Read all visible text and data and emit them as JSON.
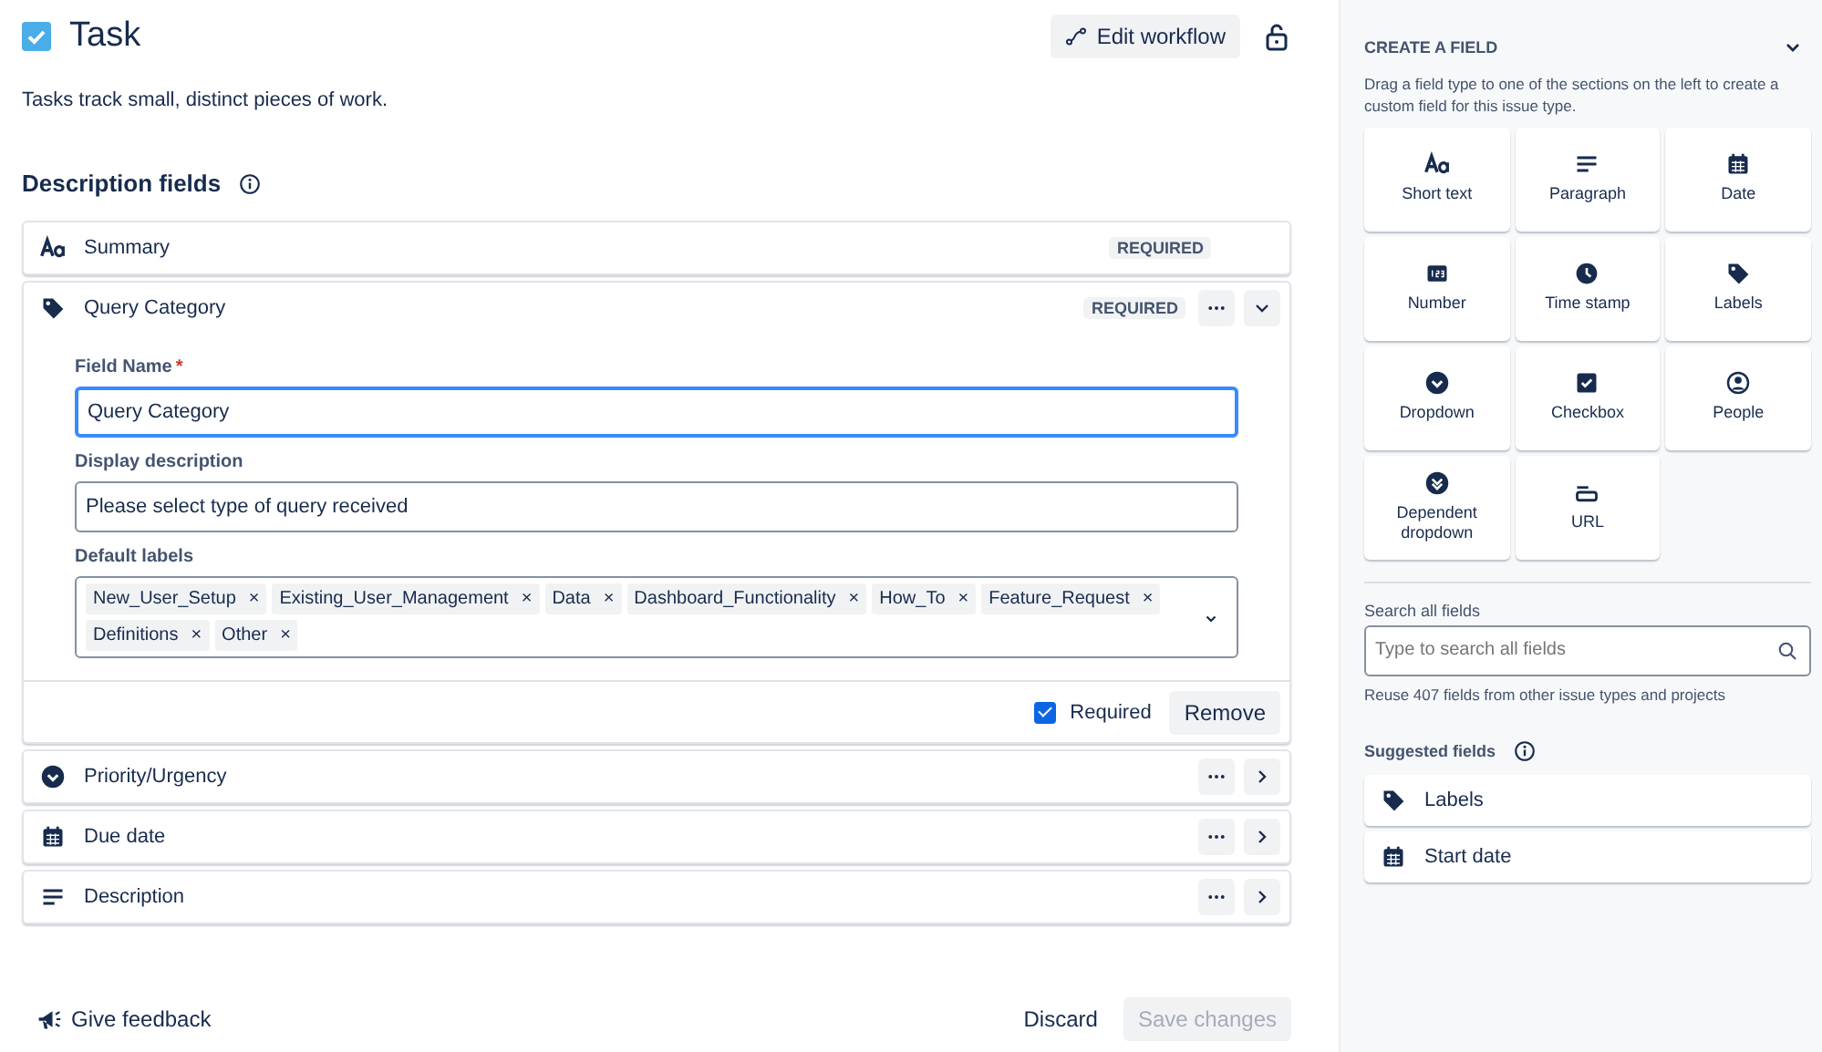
{
  "header": {
    "title": "Task",
    "edit_button": "Edit workflow",
    "description": "Tasks track small, distinct pieces of work."
  },
  "section": {
    "title": "Description fields"
  },
  "fields": [
    {
      "kind": "text",
      "name": "Summary",
      "badge": "REQUIRED",
      "expanded": false,
      "has_actions": false
    },
    {
      "kind": "labels",
      "name": "Query Category",
      "badge": "REQUIRED",
      "expanded": true,
      "has_actions": true
    },
    {
      "kind": "dropdown",
      "name": "Priority/Urgency",
      "expanded": false,
      "has_actions": true
    },
    {
      "kind": "date",
      "name": "Due date",
      "expanded": false,
      "has_actions": true
    },
    {
      "kind": "paragraph",
      "name": "Description",
      "expanded": false,
      "has_actions": true
    }
  ],
  "editor": {
    "field_name_label": "Field Name",
    "required_mark": "*",
    "field_name_value": "Query Category",
    "description_label": "Display description",
    "description_value": "Please select type of query received",
    "labels_label": "Default labels",
    "labels": [
      "New_User_Setup",
      "Existing_User_Management",
      "Data",
      "Dashboard_Functionality",
      "How_To",
      "Feature_Request",
      "Definitions",
      "Other"
    ],
    "remove_mark": "×",
    "required_label": "Required",
    "required_checked": true,
    "remove_button": "Remove"
  },
  "footer": {
    "feedback": "Give feedback",
    "discard": "Discard",
    "save": "Save changes",
    "save_disabled": true
  },
  "sidebar": {
    "create_title": "CREATE A FIELD",
    "create_hint": "Drag a field type to one of the sections on the left to create a custom field for this issue type.",
    "types": [
      {
        "kind": "text",
        "label": "Short text"
      },
      {
        "kind": "paragraph",
        "label": "Paragraph"
      },
      {
        "kind": "date",
        "label": "Date"
      },
      {
        "kind": "number",
        "label": "Number"
      },
      {
        "kind": "clock",
        "label": "Time stamp"
      },
      {
        "kind": "labels",
        "label": "Labels"
      },
      {
        "kind": "dropdown",
        "label": "Dropdown"
      },
      {
        "kind": "checkbox",
        "label": "Checkbox"
      },
      {
        "kind": "people",
        "label": "People"
      },
      {
        "kind": "dependent",
        "label": "Dependent dropdown"
      },
      {
        "kind": "url",
        "label": "URL"
      }
    ],
    "search_label": "Search all fields",
    "search_placeholder": "Type to search all fields",
    "reuse_note": "Reuse 407 fields from other issue types and projects",
    "suggested_title": "Suggested fields",
    "suggested": [
      {
        "kind": "labels",
        "label": "Labels"
      },
      {
        "kind": "date",
        "label": "Start date"
      }
    ]
  }
}
